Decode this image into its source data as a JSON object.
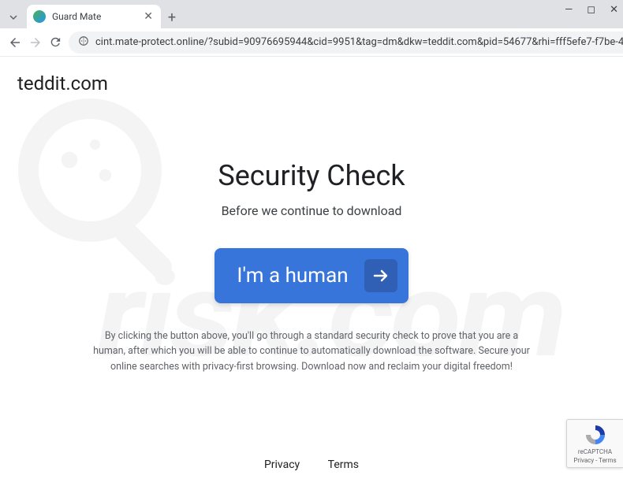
{
  "tab": {
    "title": "Guard Mate"
  },
  "omnibox": {
    "url": "cint.mate-protect.online/?subid=90976695944&cid=9951&tag=dm&dkw=teddit.com&pid=54677&rhi=fff5efe7-f7be-46…"
  },
  "page": {
    "domain": "teddit.com",
    "heading": "Security Check",
    "subheading": "Before we continue to download",
    "cta_label": "I'm a human",
    "disclaimer": "By clicking the button above, you'll go through a standard security check to prove that you are a human, after which you will be able to continue to automatically download the software. Secure your online searches with privacy-first browsing. Download now and reclaim your digital freedom!"
  },
  "footer": {
    "privacy": "Privacy",
    "terms": "Terms"
  },
  "recaptcha": {
    "line1": "reCAPTCHA",
    "line2": "Privacy - Terms"
  }
}
